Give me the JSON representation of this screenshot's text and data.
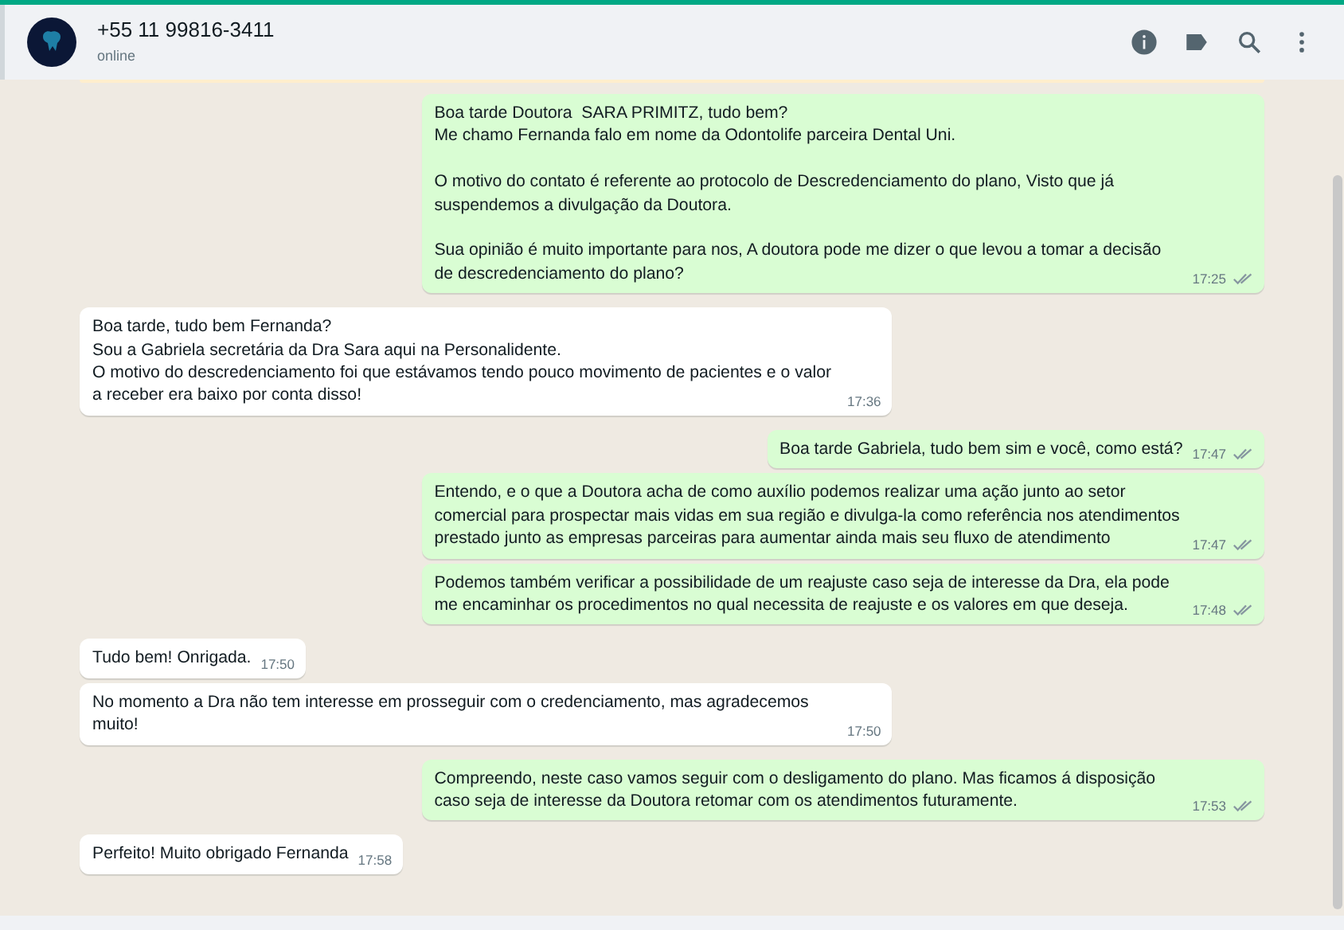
{
  "header": {
    "contact": "+55 11 99816-3411",
    "status": "online"
  },
  "messages": [
    {
      "kind": "out",
      "text": "Boa tarde Doutora  SARA PRIMITZ, tudo bem?\nMe chamo Fernanda falo em nome da Odontolife parceira Dental Uni.\n\nO motivo do contato é referente ao protocolo de Descredenciamento do plano, Visto que já suspendemos a divulgação da Doutora.\n\nSua opinião é muito importante para nos, A doutora pode me dizer o que levou a tomar a decisão de descredenciamento do plano?",
      "time": "17:25",
      "read": false
    },
    {
      "kind": "in",
      "text": "Boa tarde, tudo bem Fernanda?\nSou a Gabriela secretária da Dra Sara aqui na Personalidente.\nO motivo do descredenciamento foi que estávamos tendo pouco movimento de pacientes e o valor a receber era baixo por conta disso!",
      "time": "17:36"
    },
    {
      "kind": "out",
      "text": "Boa tarde Gabriela, tudo bem sim e você, como está?",
      "time": "17:47",
      "read": false
    },
    {
      "kind": "out",
      "text": "Entendo, e o que a Doutora acha de como auxílio podemos realizar uma ação junto ao setor comercial para prospectar mais vidas em sua região e divulga-la como referência nos atendimentos prestado junto as empresas parceiras para aumentar ainda mais seu fluxo de atendimento",
      "time": "17:47",
      "read": false
    },
    {
      "kind": "out",
      "text": "Podemos também verificar a possibilidade de um reajuste caso seja de interesse da Dra, ela pode me encaminhar os procedimentos no qual necessita de reajuste e os valores em que deseja.\n",
      "time": "17:48",
      "read": false
    },
    {
      "kind": "in",
      "text": "Tudo bem! Onrigada.",
      "time": "17:50"
    },
    {
      "kind": "in",
      "text": "No momento a Dra não tem interesse em prosseguir com o credenciamento, mas agradecemos muito!",
      "time": "17:50"
    },
    {
      "kind": "out",
      "text": "Compreendo, neste caso vamos seguir com o desligamento do plano. Mas ficamos á disposição caso seja de interesse da Doutora retomar com os atendimentos futuramente.",
      "time": "17:53",
      "read": false
    },
    {
      "kind": "in",
      "text": "Perfeito! Muito obrigado Fernanda",
      "time": "17:58"
    }
  ]
}
